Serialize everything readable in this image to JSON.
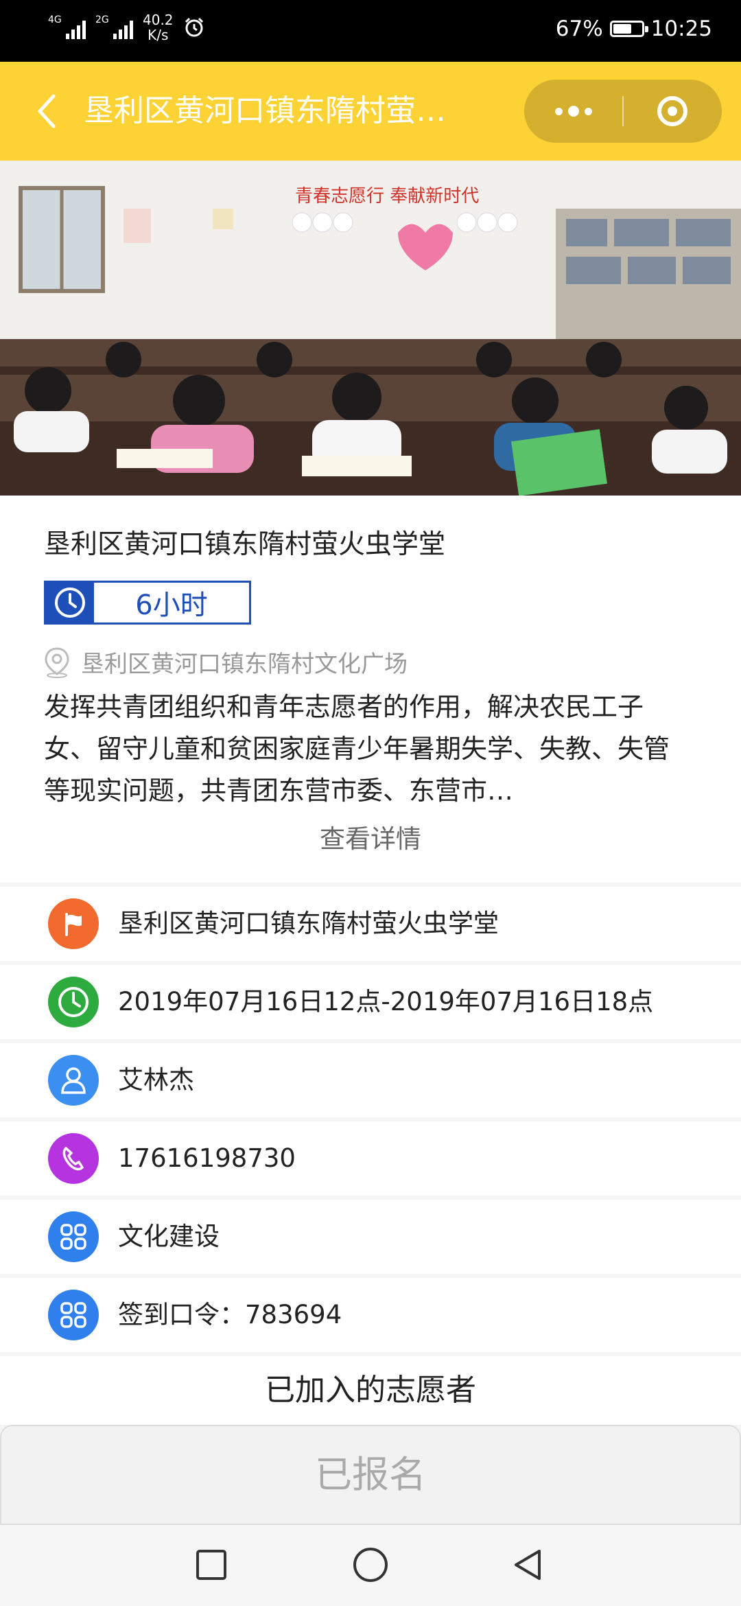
{
  "status_bar": {
    "network1": "4G",
    "network2": "2G",
    "speed_value": "40.2",
    "speed_unit": "K/s",
    "battery_percent": "67%",
    "battery_level": 0.67,
    "time": "10:25"
  },
  "navbar": {
    "title": "垦利区黄河口镇东隋村萤火虫学堂",
    "more_icon": "more-dots-icon",
    "close_icon": "target-close-icon",
    "color": "#fdd235"
  },
  "activity": {
    "title": "垦利区黄河口镇东隋村萤火虫学堂",
    "duration": "6小时",
    "location": "垦利区黄河口镇东隋村文化广场",
    "description": "发挥共青团组织和青年志愿者的作用，解决农民工子女、留守儿童和贫困家庭青少年暑期失学、失教、失管等现实问题，共青团东营市委、东营市…",
    "detail_link": "查看详情",
    "banner_text": "青春志愿行 奉献新时代"
  },
  "details": [
    {
      "icon": "flag-icon",
      "color": "#f26a2e",
      "text": "垦利区黄河口镇东隋村萤火虫学堂"
    },
    {
      "icon": "clock-icon",
      "color": "#2eab3f",
      "text": "2019年07月16日12点-2019年07月16日18点"
    },
    {
      "icon": "person-icon",
      "color": "#3b8ff0",
      "text": "艾林杰"
    },
    {
      "icon": "phone-icon",
      "color": "#b634e0",
      "text": "17616198730"
    },
    {
      "icon": "grid-icon",
      "color": "#2f80ed",
      "text": "文化建设"
    },
    {
      "icon": "grid-icon",
      "color": "#2f80ed",
      "text": "签到口令：783694"
    }
  ],
  "joined_heading": "已加入的志愿者",
  "signup_button": "已报名",
  "system_nav": {
    "recent": "square-recent-icon",
    "home": "circle-home-icon",
    "back": "triangle-back-icon"
  }
}
